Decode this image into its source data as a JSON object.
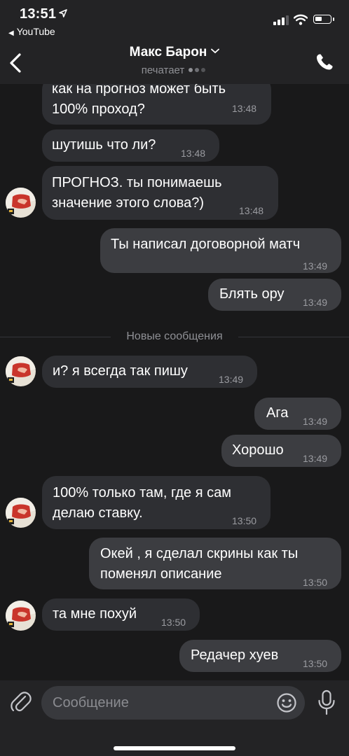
{
  "status_bar": {
    "time": "13:51",
    "back_app": "YouTube"
  },
  "header": {
    "contact_name": "Макс Барон",
    "status": "печатает"
  },
  "divider_label": "Новые сообщения",
  "messages": [
    {
      "dir": "in",
      "lines": [
        "как на прогноз может быть",
        "100% проход?"
      ],
      "time": "13:48"
    },
    {
      "dir": "in",
      "lines": [
        "шутишь что ли?"
      ],
      "time": "13:48"
    },
    {
      "dir": "in",
      "lines": [
        "ПРОГНОЗ. ты понимаешь",
        "значение этого слова?)"
      ],
      "time": "13:48"
    },
    {
      "dir": "out",
      "lines": [
        "Ты написал договорной матч"
      ],
      "time": "13:49"
    },
    {
      "dir": "out",
      "lines": [
        "Блять ору"
      ],
      "time": "13:49"
    },
    {
      "dir": "in",
      "lines": [
        "и? я всегда так пишу"
      ],
      "time": "13:49"
    },
    {
      "dir": "out",
      "lines": [
        "Ага"
      ],
      "time": "13:49"
    },
    {
      "dir": "out",
      "lines": [
        "Хорошо"
      ],
      "time": "13:49"
    },
    {
      "dir": "in",
      "lines": [
        "100% только там, где я сам",
        "делаю ставку."
      ],
      "time": "13:50"
    },
    {
      "dir": "out",
      "lines": [
        "Окей , я сделал скрины как ты",
        "поменял описание"
      ],
      "time": "13:50"
    },
    {
      "dir": "in",
      "lines": [
        "та мне похуй"
      ],
      "time": "13:50"
    },
    {
      "dir": "out",
      "lines": [
        "Редачер хуев"
      ],
      "time": "13:50"
    }
  ],
  "composer": {
    "placeholder": "Сообщение"
  },
  "colors": {
    "background": "#19191a",
    "bar": "#232325",
    "incoming_bubble": "#2e2f33",
    "outgoing_bubble": "#3c3d41",
    "input": "#38393d",
    "muted_text": "#8f9095"
  },
  "icons": [
    "location-arrow-icon",
    "signal-icon",
    "wifi-icon",
    "battery-icon",
    "back-chevron-icon",
    "chevron-down-icon",
    "phone-icon",
    "attach-icon",
    "emoji-icon",
    "microphone-icon"
  ]
}
